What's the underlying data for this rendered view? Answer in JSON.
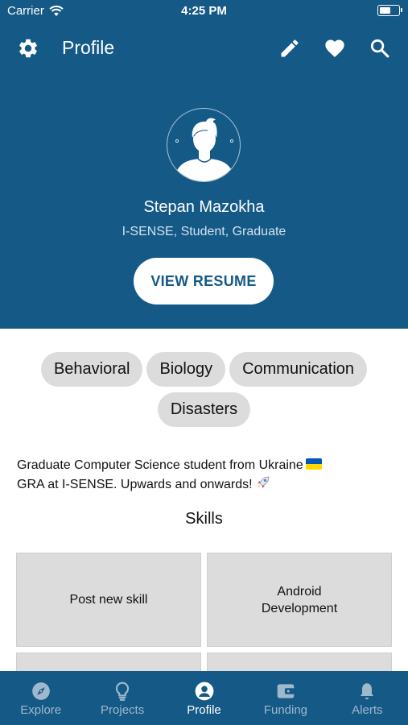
{
  "status_bar": {
    "carrier": "Carrier",
    "time": "4:25 PM",
    "battery_level": 0.6
  },
  "topbar": {
    "title": "Profile"
  },
  "profile": {
    "name": "Stepan Mazokha",
    "subtitle": "I-SENSE, Student, Graduate",
    "resume_button": "VIEW RESUME"
  },
  "tags": [
    "Behavioral",
    "Biology",
    "Communication",
    "Disasters"
  ],
  "bio": {
    "line1": "Graduate Computer Science student from Ukraine",
    "line2": "GRA at I-SENSE. Upwards and onwards!"
  },
  "skills": {
    "title": "Skills",
    "items": [
      "Post new skill",
      "Android\nDevelopment",
      "",
      ""
    ]
  },
  "tabbar": {
    "tabs": [
      {
        "label": "Explore",
        "icon": "compass-icon"
      },
      {
        "label": "Projects",
        "icon": "lightbulb-icon"
      },
      {
        "label": "Profile",
        "icon": "account-icon"
      },
      {
        "label": "Funding",
        "icon": "wallet-icon"
      },
      {
        "label": "Alerts",
        "icon": "bell-icon"
      }
    ],
    "active": "Profile"
  },
  "colors": {
    "primary": "#155987",
    "chip": "#dcdcdc",
    "inactive_tab": "#9fb8cc"
  }
}
